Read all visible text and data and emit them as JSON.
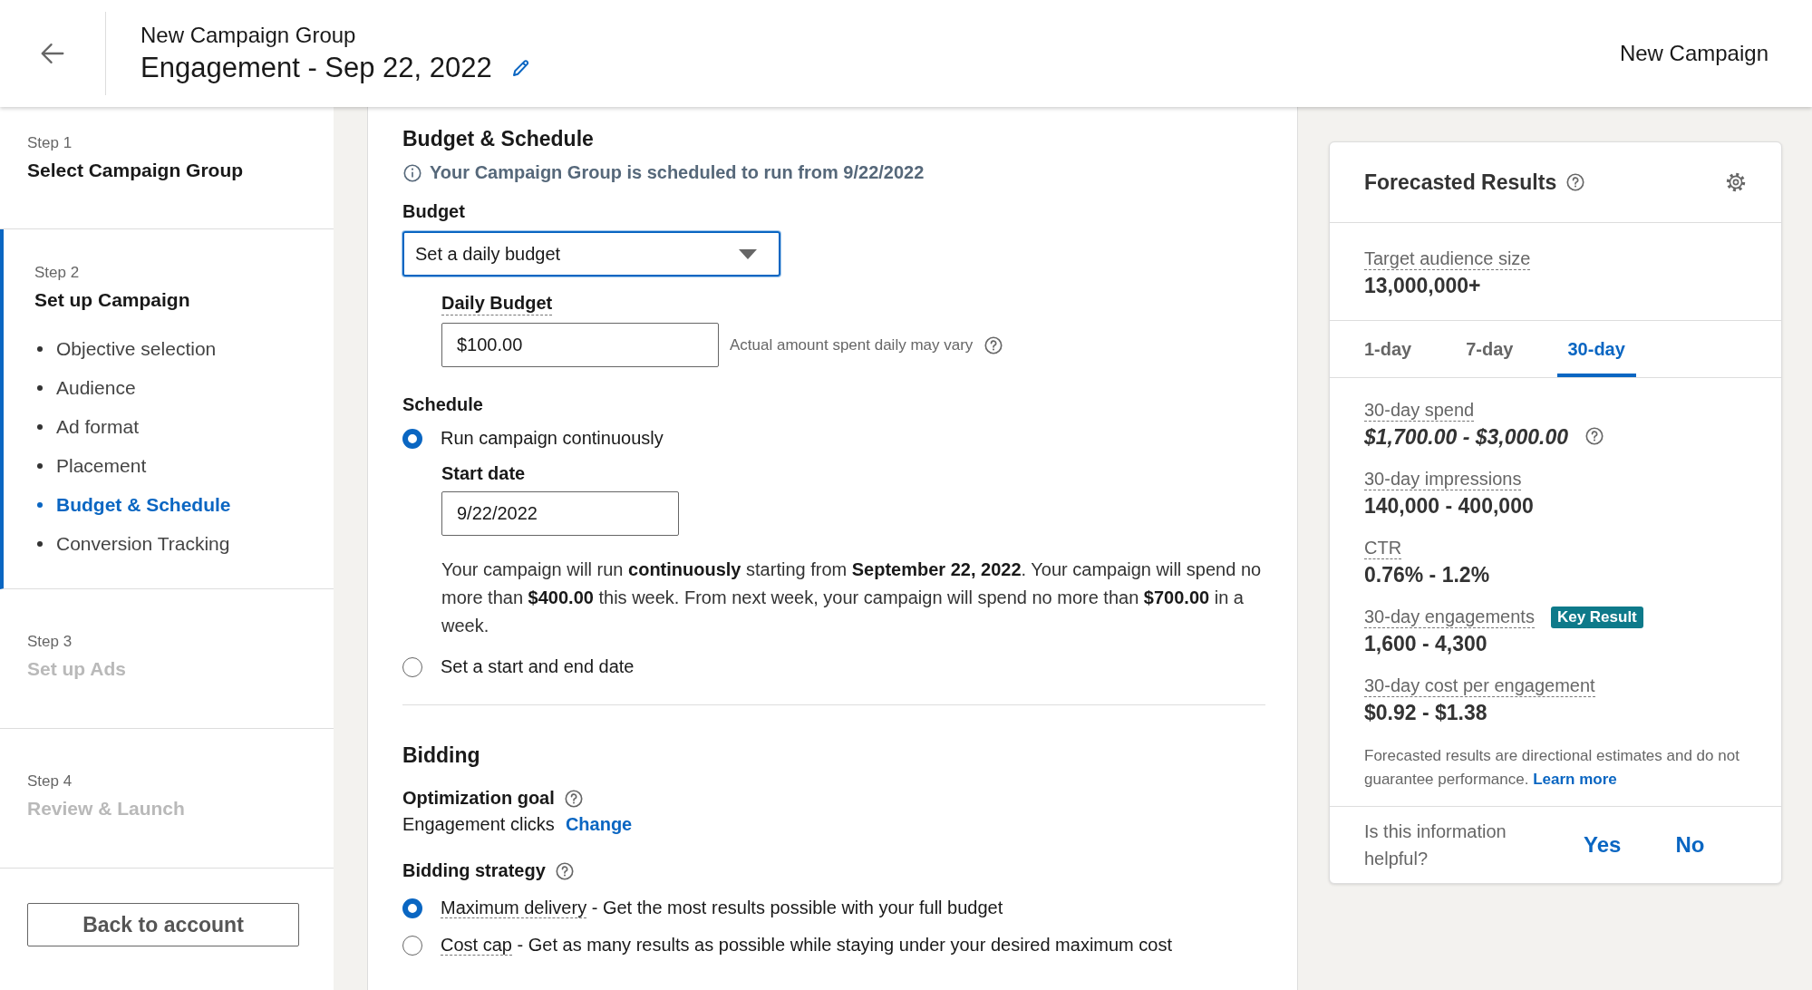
{
  "header": {
    "group_name": "New Campaign Group",
    "campaign_name": "Engagement - Sep 22, 2022",
    "page_title": "New Campaign"
  },
  "steps": [
    {
      "step": "Step 1",
      "title": "Select Campaign Group",
      "selected": false,
      "disabled": false
    },
    {
      "step": "Step 2",
      "title": "Set up Campaign",
      "selected": true,
      "disabled": false,
      "items": [
        {
          "label": "Objective selection",
          "selected": false
        },
        {
          "label": "Audience",
          "selected": false
        },
        {
          "label": "Ad format",
          "selected": false
        },
        {
          "label": "Placement",
          "selected": false
        },
        {
          "label": "Budget & Schedule",
          "selected": true
        },
        {
          "label": "Conversion Tracking",
          "selected": false
        }
      ]
    },
    {
      "step": "Step 3",
      "title": "Set up Ads",
      "selected": false,
      "disabled": true
    },
    {
      "step": "Step 4",
      "title": "Review & Launch",
      "selected": false,
      "disabled": true
    }
  ],
  "back_button": "Back to account",
  "budget_schedule": {
    "heading": "Budget & Schedule",
    "notice": "Your Campaign Group is scheduled to run from 9/22/2022",
    "budget_label": "Budget",
    "budget_select": "Set a daily budget",
    "daily_budget_label": "Daily Budget",
    "daily_budget_value": "$100.00",
    "daily_budget_hint": "Actual amount spent daily may vary",
    "schedule_label": "Schedule",
    "options": [
      {
        "label": "Run campaign continuously",
        "selected": true,
        "start_date_label": "Start date",
        "start_date_value": "9/22/2022",
        "summary": "Your campaign will run **continuously** starting from **September 22, 2022**. Your campaign will spend no more than **$400.00** this week. From next week, your campaign will spend no more than **$700.00** in a week."
      },
      {
        "label": "Set a start and end date",
        "selected": false
      }
    ]
  },
  "bidding": {
    "heading": "Bidding",
    "goal_label": "Optimization goal",
    "goal_value": "Engagement clicks",
    "goal_link": "Change",
    "strategy_label": "Bidding strategy",
    "strategies": [
      {
        "name": "Maximum delivery",
        "description": "- Get the most results possible with your full budget",
        "selected": true
      },
      {
        "name": "Cost cap",
        "description": "- Get as many results as possible while staying under your desired maximum cost",
        "selected": false
      }
    ]
  },
  "forecast": {
    "title": "Forecasted Results",
    "audience_label": "Target audience size",
    "audience_value": "13,000,000+",
    "tabs": [
      {
        "label": "1-day",
        "selected": false
      },
      {
        "label": "7-day",
        "selected": false
      },
      {
        "label": "30-day",
        "selected": true
      }
    ],
    "metrics": [
      {
        "kind": "estimate",
        "label": "30-day spend",
        "value": "$1,700.00 - $3,000.00"
      },
      {
        "kind": "plain",
        "label": "30-day impressions",
        "value": "140,000 - 400,000"
      },
      {
        "kind": "plain",
        "label": "CTR",
        "value": "0.76% - 1.2%"
      },
      {
        "kind": "plain",
        "label": "30-day engagements",
        "value": "1,600 - 4,300",
        "badge": "Key Result"
      },
      {
        "kind": "plain",
        "label": "30-day cost per engagement",
        "value": "$0.92 - $1.38"
      }
    ],
    "disclaimer": "Forecasted results are directional estimates and do not guarantee performance.",
    "disclaimer_link": "Learn more",
    "feedback_question": "Is this information helpful?",
    "feedback_buttons": [
      "Yes",
      "No"
    ]
  }
}
